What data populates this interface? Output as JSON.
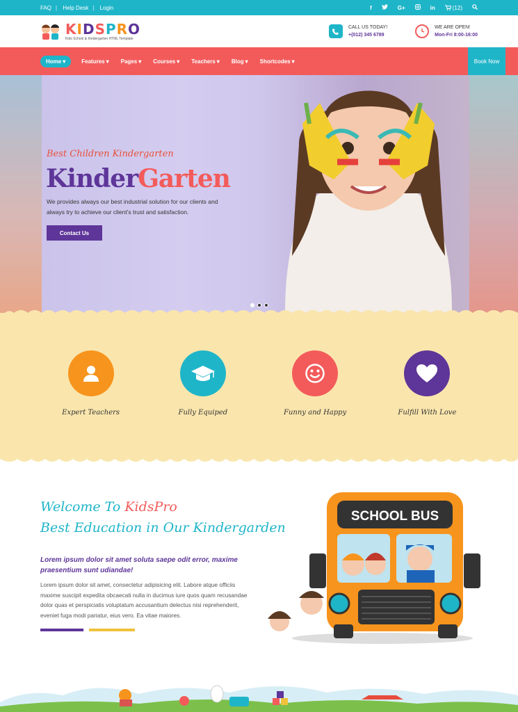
{
  "topbar": {
    "links": [
      "FAQ",
      "Help Desk",
      "Login"
    ],
    "social_icons": [
      "facebook-icon",
      "twitter-icon",
      "google-plus-icon",
      "instagram-icon",
      "linkedin-icon"
    ],
    "cart_label": "(12)"
  },
  "logo": {
    "title": "KIDSPRO",
    "subtitle": "Kids School & Kindergarten HTML Template"
  },
  "contacts": {
    "call_label": "CALL US TODAY!",
    "call_value": "+(012) 345 6789",
    "open_label": "WE ARE OPEN!",
    "open_value": "Mon-Fri 8:00-16:00"
  },
  "nav": {
    "items": [
      "Home",
      "Features",
      "Pages",
      "Courses",
      "Teachers",
      "Blog",
      "Shortcodes"
    ],
    "book_label": "Book Now"
  },
  "hero": {
    "subtitle": "Best Children Kindergarten",
    "title_a": "Kinder",
    "title_b": "Garten",
    "description": "We provides always our best industrial solution for our clients and always try to achieve our client's trust and satisfaction.",
    "button": "Contact Us"
  },
  "features": [
    {
      "label": "Expert Teachers",
      "color": "#f7941d",
      "icon": "user-icon"
    },
    {
      "label": "Fully Equiped",
      "color": "#1fb5c9",
      "icon": "graduation-cap-icon"
    },
    {
      "label": "Funny and Happy",
      "color": "#f35b5b",
      "icon": "smile-icon"
    },
    {
      "label": "Fulfill With Love",
      "color": "#5e3599",
      "icon": "heart-icon"
    }
  ],
  "welcome": {
    "title_prefix": "Welcome To ",
    "title_brand": "KidsPro",
    "title2": "Best Education in Our Kindergarden",
    "lead": "Lorem ipsum dolor sit amet soluta saepe odit error, maxime praesentium sunt udiandae!",
    "body": "Lorem ipsum dolor sit amet, consectetur adipisicing elit. Labore atque officiis maxime suscipit expedita obcaecati nulla in ducimus iure quos quam recusandae dolor quas et perspiciatis voluptatum accusantium delectus nisi reprehenderit, eveniet fuga modi pariatur, eius vero. Ea vitae maiores.",
    "bus_sign": "SCHOOL BUS"
  },
  "colors": {
    "teal": "#1fb5c9",
    "coral": "#f35b5b",
    "purple": "#5e3599",
    "yellow": "#fae6ad"
  }
}
